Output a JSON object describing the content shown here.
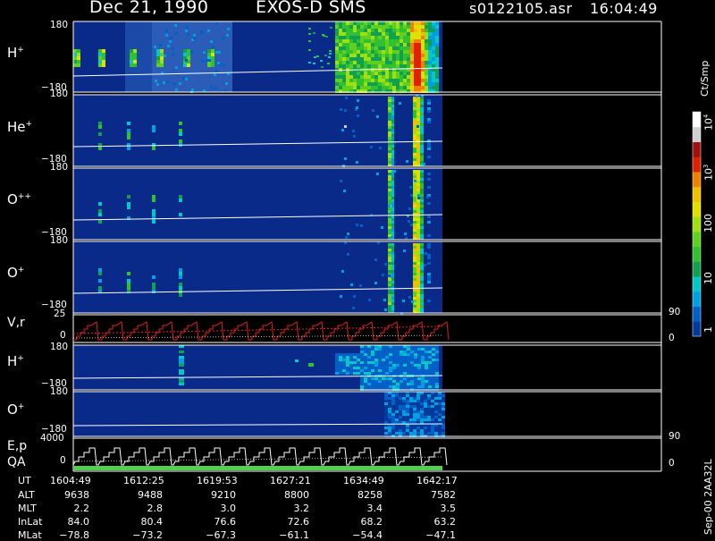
{
  "header": {
    "date": "Dec 21, 1990",
    "instrument": "EXOS-D SMS",
    "file": "s0122105.asr",
    "time": "16:04:49"
  },
  "colorbar": {
    "unit": "Ct/Smp",
    "ticks": [
      "1",
      "10",
      "100",
      "10",
      "10",
      "4",
      "3"
    ],
    "tick_labels": [
      {
        "value": 1,
        "text": "1"
      },
      {
        "value": 10,
        "text": "10"
      },
      {
        "value": 100,
        "text": "100"
      },
      {
        "value": 1000,
        "text": "10",
        "sup": "3"
      },
      {
        "value": 10000,
        "text": "10",
        "sup": "4"
      }
    ],
    "colors": [
      "#003a9a",
      "#0060c8",
      "#00a0e0",
      "#00c8c8",
      "#10a050",
      "#30c030",
      "#60d020",
      "#a0e010",
      "#e0e000",
      "#f0c000",
      "#f08000",
      "#e02000",
      "#a01010",
      "#d0d0d0",
      "#ffffff"
    ]
  },
  "panels": [
    {
      "ion": "H",
      "charge": "+",
      "ymax": "180",
      "ymin": "−180"
    },
    {
      "ion": "He",
      "charge": "+",
      "ymax": "180",
      "ymin": "−180"
    },
    {
      "ion": "O",
      "charge": "++",
      "ymax": "180",
      "ymin": "−180"
    },
    {
      "ion": "O",
      "charge": "+",
      "ymax": "180",
      "ymin": "−180"
    }
  ],
  "vr_panel": {
    "label": "V,r",
    "ymax": "25",
    "ymin": "0",
    "right_max": "90",
    "right_min": "0"
  },
  "lower_panels": [
    {
      "ion": "H",
      "charge": "+",
      "ymax": "180",
      "ymin": "−180"
    },
    {
      "ion": "O",
      "charge": "+",
      "ymax": "180",
      "ymin": "−180"
    }
  ],
  "ep_panel": {
    "label1": "E,p",
    "label2": "QA",
    "ymax": "4000",
    "ymin": "0",
    "right_max": "90",
    "right_min": "0"
  },
  "table": {
    "rows": [
      {
        "label": "UT",
        "values": [
          "1604:49",
          "1612:25",
          "1619:53",
          "1627:21",
          "1634:49",
          "1642:17"
        ]
      },
      {
        "label": "ALT",
        "values": [
          "9638",
          "9488",
          "9210",
          "8800",
          "8258",
          "7582"
        ]
      },
      {
        "label": "MLT",
        "values": [
          "2.2",
          "2.8",
          "3.0",
          "3.2",
          "3.4",
          "3.5"
        ]
      },
      {
        "label": "InLat",
        "values": [
          "84.0",
          "80.4",
          "76.6",
          "72.6",
          "68.2",
          "63.2"
        ]
      },
      {
        "label": "MLat",
        "values": [
          "−78.8",
          "−73.2",
          "−67.3",
          "−61.1",
          "−54.4",
          "−47.1"
        ]
      }
    ]
  },
  "footer": {
    "stamp": "Sep-00  2AA32L"
  },
  "chart_data": {
    "type": "heatmap",
    "title": "Dec 21, 1990   EXOS-D SMS",
    "x_label": "UT",
    "x_ticks": [
      "1604:49",
      "1612:25",
      "1619:53",
      "1627:21",
      "1634:49",
      "1642:17"
    ],
    "y_range": [
      -180,
      180
    ],
    "color_scale": "log",
    "color_range": [
      1,
      10000
    ],
    "color_unit": "Ct/Smp",
    "series": [
      "H+",
      "He+",
      "O++",
      "O+",
      "V,r",
      "H+",
      "O+",
      "E,p QA"
    ]
  }
}
